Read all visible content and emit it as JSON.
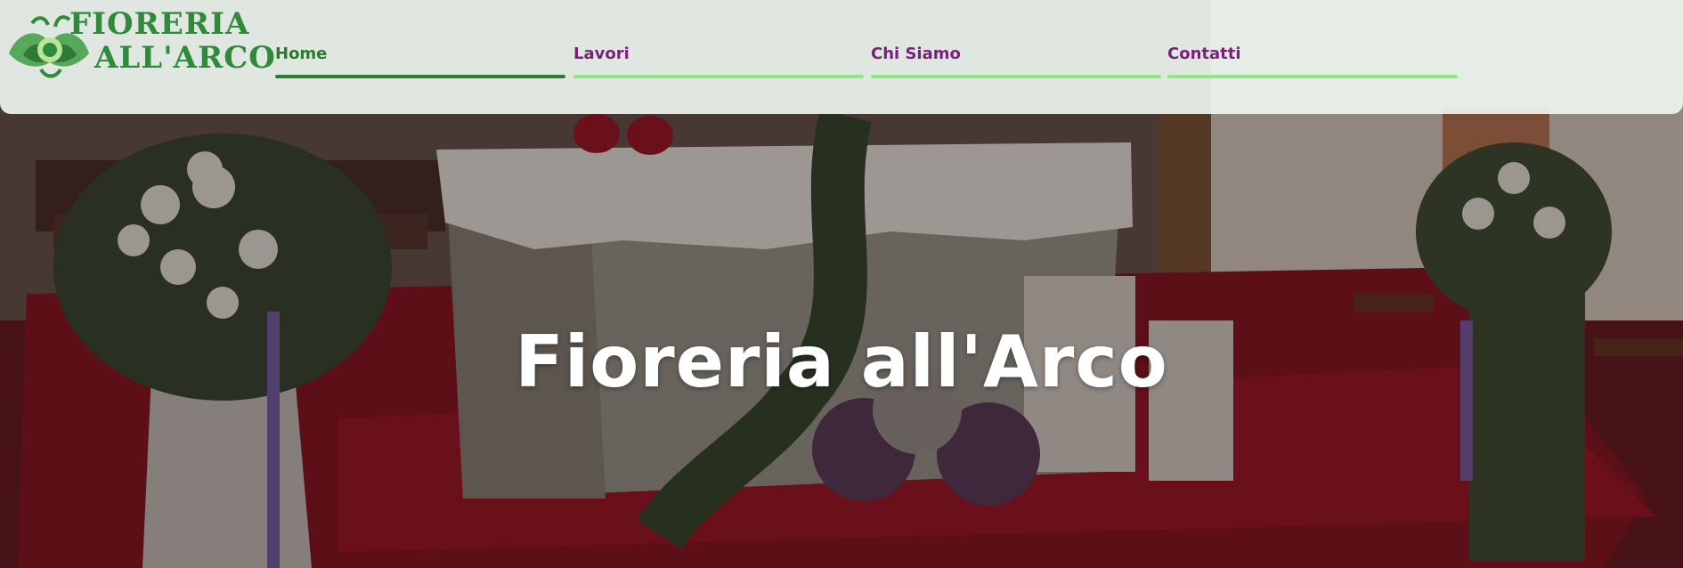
{
  "logo": {
    "line1": "FIORERIA",
    "line2": "ALL'ARCO",
    "color": "#2f8a3c",
    "icon": "flower-logo-icon"
  },
  "nav": {
    "items": [
      {
        "label": "Home",
        "active": true
      },
      {
        "label": "Lavori",
        "active": false
      },
      {
        "label": "Chi Siamo",
        "active": false
      },
      {
        "label": "Contatti",
        "active": false
      }
    ],
    "colors": {
      "active_text": "#2c7a2f",
      "text": "#7b1f7e",
      "active_underline": "#2e7d32",
      "underline": "#8fe884"
    }
  },
  "hero": {
    "title": "Fioreria all'Arco"
  }
}
